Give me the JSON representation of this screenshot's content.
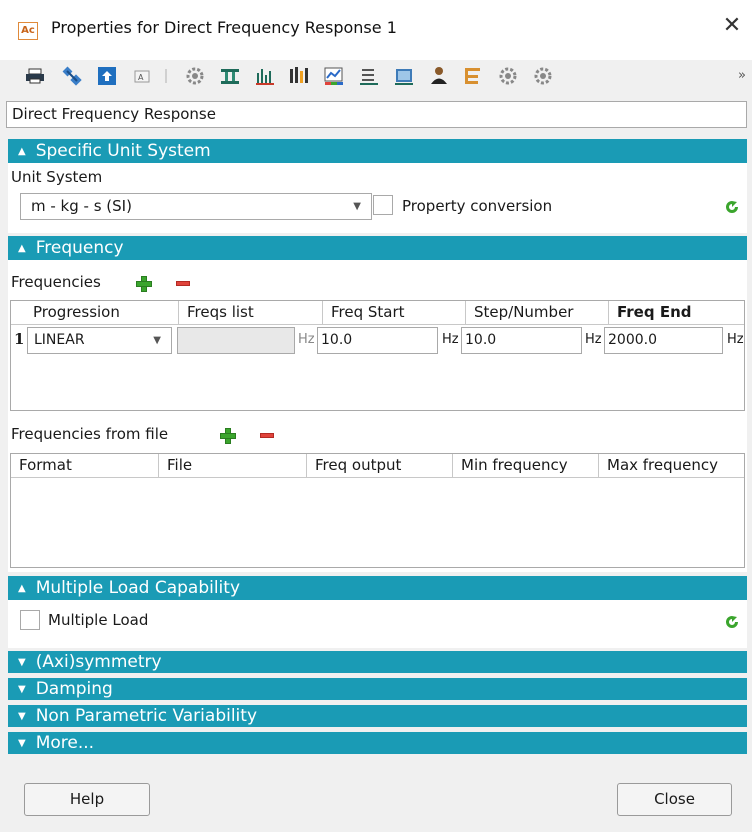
{
  "window": {
    "app_icon_text": "Ac",
    "title": "Properties for Direct Frequency Response 1",
    "close_glyph": "✕"
  },
  "toolbar": {
    "icons": [
      "print-icon",
      "satellite-icon",
      "export-icon",
      "text-icon",
      "settings-gear-icon",
      "beam-icon",
      "bar-chart-icon",
      "signal-bars-icon",
      "color-chart-icon",
      "list-icon",
      "panel-icon",
      "person-icon",
      "tree-icon",
      "gear-group-icon",
      "gear-group-icon-2"
    ],
    "more_glyph": "»"
  },
  "name_field": {
    "value": "Direct Frequency Response"
  },
  "sections": {
    "unit_system": {
      "header": "Specific Unit System",
      "label": "Unit System",
      "selected": "m - kg - s (SI)",
      "property_conversion_label": "Property conversion",
      "property_conversion_checked": false
    },
    "frequency": {
      "header": "Frequency",
      "frequencies_label": "Frequencies",
      "columns": [
        "Progression",
        "Freqs list",
        "Freq Start",
        "Step/Number",
        "Freq End"
      ],
      "rows": [
        {
          "index": "1",
          "progression": "LINEAR",
          "freqs_list": "",
          "unit_start_prefix": "Hz",
          "freq_start": "10.0",
          "unit_step_prefix": "Hz",
          "step_number": "10.0",
          "unit_end_prefix": "Hz",
          "freq_end": "2000.0",
          "unit_end_suffix": "Hz"
        }
      ],
      "file_label": "Frequencies from file",
      "file_columns": [
        "Format",
        "File",
        "Freq output",
        "Min frequency",
        "Max frequency"
      ]
    },
    "multiple_load": {
      "header": "Multiple Load Capability",
      "checkbox_label": "Multiple Load",
      "checked": false
    },
    "collapsed": [
      "(Axi)symmetry",
      "Damping",
      "Non Parametric Variability",
      "More..."
    ]
  },
  "buttons": {
    "help": "Help",
    "close": "Close"
  },
  "colors": {
    "section_header": "#1a9bb5",
    "plus": "#3ba52d",
    "minus": "#e0433b"
  }
}
